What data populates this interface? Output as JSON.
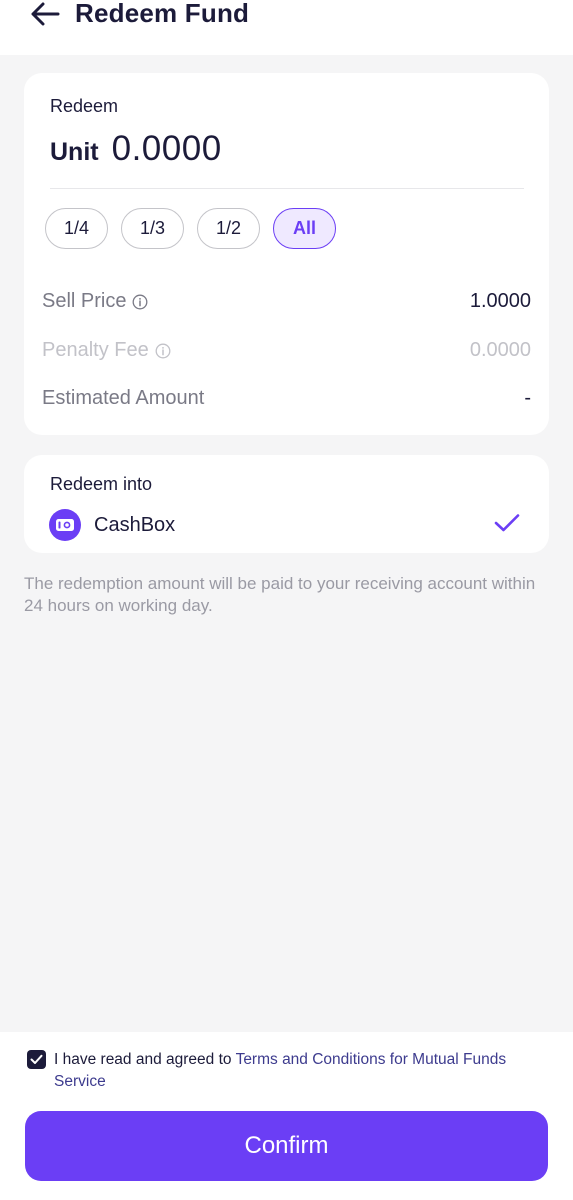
{
  "header": {
    "title": "Redeem Fund",
    "back_icon": "arrow-left-icon"
  },
  "redeem": {
    "label": "Redeem",
    "unit_label": "Unit",
    "unit_value": "0.0000",
    "fractions": [
      "1/4",
      "1/3",
      "1/2",
      "All"
    ],
    "selected_fraction": "All",
    "sell_price_label": "Sell Price",
    "sell_price_value": "1.0000",
    "penalty_fee_label": "Penalty Fee",
    "penalty_fee_value": "0.0000",
    "estimated_amount_label": "Estimated Amount",
    "estimated_amount_value": "-"
  },
  "redeem_into": {
    "label": "Redeem into",
    "account": "CashBox",
    "selected": true
  },
  "notice": "The redemption amount will be paid to your receiving account within 24 hours on working day.",
  "agreement": {
    "checked": true,
    "prefix": "I have read and agreed to ",
    "link": "Terms and Conditions for Mutual Funds Service"
  },
  "confirm_label": "Confirm",
  "colors": {
    "accent": "#6b3ef5",
    "text_primary": "#1c1b3a",
    "text_secondary": "#7a7a86",
    "background": "#f5f5f6"
  }
}
